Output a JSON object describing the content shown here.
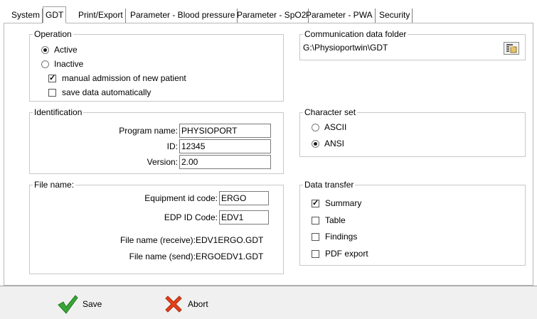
{
  "tabs": [
    {
      "label": "System",
      "active": false
    },
    {
      "label": "GDT",
      "active": true
    },
    {
      "label": "Print/Export",
      "active": false
    },
    {
      "label": "Parameter - Blood pressure",
      "active": false
    },
    {
      "label": "Parameter - SpO2",
      "active": false
    },
    {
      "label": "Parameter - PWA",
      "active": false
    },
    {
      "label": "Security",
      "active": false
    }
  ],
  "operation": {
    "title": "Operation",
    "active_label": "Active",
    "inactive_label": "Inactive",
    "selected": "Active",
    "manual_admission_label": "manual admission of new patient",
    "manual_admission_checked": true,
    "save_auto_label": "save data automatically",
    "save_auto_checked": false
  },
  "communication": {
    "title": "Communication data folder",
    "path": "G:\\Physioportwin\\GDT"
  },
  "identification": {
    "title": "Identification",
    "program_name_label": "Program name:",
    "program_name": "PHYSIOPORT",
    "id_label": "ID:",
    "id": "12345",
    "version_label": "Version:",
    "version": "2.00"
  },
  "charset": {
    "title": "Character set",
    "ascii_label": "ASCII",
    "ansi_label": "ANSI",
    "selected": "ANSI"
  },
  "filename": {
    "title": "File name:",
    "equipment_label": "Equipment id code:",
    "equipment": "ERGO",
    "edp_label": "EDP ID Code:",
    "edp": "EDV1",
    "receive_label": "File name (receive):",
    "receive": "EDV1ERGO.GDT",
    "send_label": "File name (send):",
    "send": "ERGOEDV1.GDT"
  },
  "data_transfer": {
    "title": "Data transfer",
    "summary_label": "Summary",
    "summary_checked": true,
    "table_label": "Table",
    "table_checked": false,
    "findings_label": "Findings",
    "findings_checked": false,
    "pdf_label": "PDF export",
    "pdf_checked": false
  },
  "buttons": {
    "save_label": "Save",
    "abort_label": "Abort"
  },
  "colors": {
    "save_icon": "#3aa537",
    "abort_icon": "#e8401a"
  },
  "icons": {
    "save": "check-icon",
    "abort": "x-icon",
    "folder": "folder-browse-icon"
  }
}
